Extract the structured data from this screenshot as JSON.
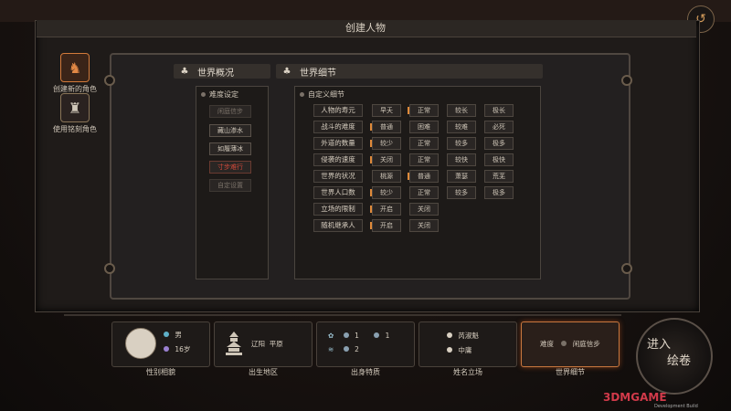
{
  "header": {
    "title": "创建人物",
    "back_icon": "return-arrow-icon"
  },
  "sidebar": {
    "items": [
      {
        "label": "创建新的角色",
        "icon": "new-character-icon",
        "active": true
      },
      {
        "label": "使用铭刻角色",
        "icon": "inscribed-character-icon",
        "active": false
      }
    ]
  },
  "overview": {
    "header": "世界概况",
    "difficulty_title": "难度设定",
    "difficulty_options": [
      "闲庭信步",
      "藏山渗水",
      "如履薄冰",
      "寸步难行",
      "自定设置"
    ]
  },
  "details": {
    "header": "世界细节",
    "custom_title": "自定义细节",
    "rows": [
      {
        "label": "人物的寿元",
        "options": [
          "早夭",
          "正常",
          "较长",
          "极长"
        ]
      },
      {
        "label": "战斗的难度",
        "options": [
          "普通",
          "困难",
          "较难",
          "必死"
        ]
      },
      {
        "label": "外道的数量",
        "options": [
          "较少",
          "正常",
          "较多",
          "极多"
        ]
      },
      {
        "label": "侵袭的速度",
        "options": [
          "关闭",
          "正常",
          "较快",
          "极快"
        ]
      },
      {
        "label": "世界的状况",
        "options": [
          "桃源",
          "普通",
          "萧瑟",
          "荒芜"
        ]
      },
      {
        "label": "世界人口数",
        "options": [
          "较少",
          "正常",
          "较多",
          "极多"
        ]
      },
      {
        "label": "立场的限制",
        "options": [
          "开启",
          "关闭"
        ]
      },
      {
        "label": "随机继承人",
        "options": [
          "开启",
          "关闭"
        ]
      }
    ]
  },
  "bottom": {
    "cards": [
      {
        "label": "性别相貌",
        "gender": "男",
        "age": "16岁"
      },
      {
        "label": "出生地区",
        "region": "辽阳",
        "terrain": "平原"
      },
      {
        "label": "出身特质",
        "v1": "1",
        "v2": "1",
        "v3": "2"
      },
      {
        "label": "姓名立场",
        "name": "芮淑魁",
        "stance": "中庸"
      },
      {
        "label": "世界细节",
        "difficulty_label": "难度",
        "difficulty": "闲庭信步"
      }
    ],
    "enter_line1": "进入",
    "enter_line2": "绘卷"
  },
  "watermark": {
    "brand": "3DMGAME",
    "sub": "Development Build"
  },
  "colors": {
    "accent": "#e08a3a",
    "danger": "#d24a3a",
    "panel": "#1f1b19"
  }
}
